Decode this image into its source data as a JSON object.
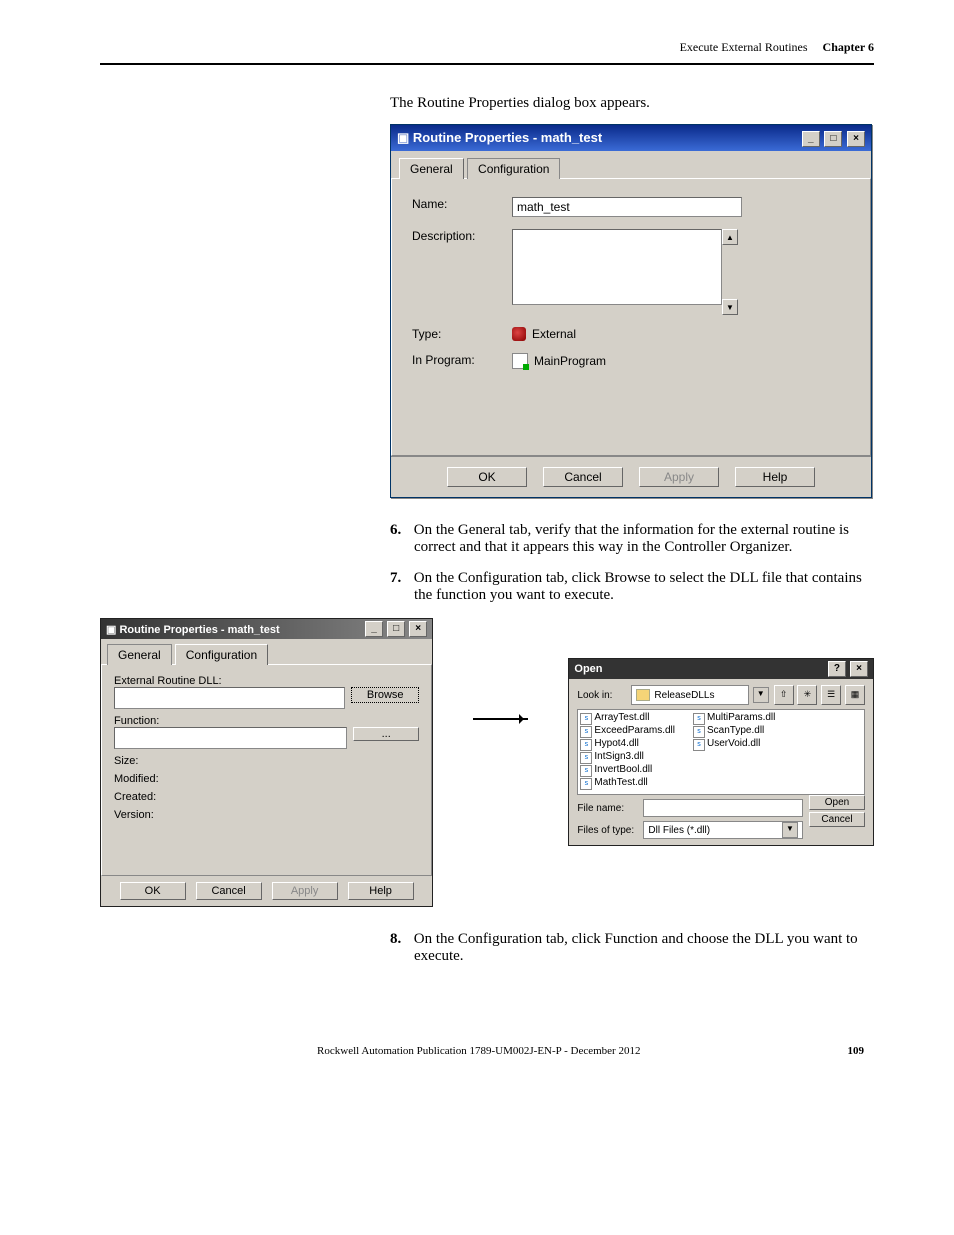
{
  "header": {
    "section_title": "Execute External Routines",
    "chapter": "Chapter 6"
  },
  "intro": "The Routine Properties dialog box appears.",
  "dialog1": {
    "title": "Routine Properties - math_test",
    "winbuttons": {
      "min": "_",
      "max": "□",
      "close": "×"
    },
    "tabs": {
      "general": "General",
      "configuration": "Configuration"
    },
    "labels": {
      "name": "Name:",
      "description": "Description:",
      "type": "Type:",
      "in_program": "In Program:"
    },
    "values": {
      "name": "math_test",
      "description": "",
      "type": "External",
      "in_program": "MainProgram"
    },
    "buttons": {
      "ok": "OK",
      "cancel": "Cancel",
      "apply": "Apply",
      "help": "Help"
    }
  },
  "step6": {
    "num": "6.",
    "text": "On the General tab, verify that the information for the external routine is correct and that it appears this way in the Controller Organizer."
  },
  "step7": {
    "num": "7.",
    "text": "On the Configuration tab, click Browse to select the DLL file that contains the function you want to execute."
  },
  "dialog2": {
    "title": "Routine Properties - math_test",
    "winbuttons": {
      "min": "_",
      "max": "□",
      "close": "×"
    },
    "tabs": {
      "general": "General",
      "configuration": "Configuration"
    },
    "labels": {
      "dll": "External Routine DLL:",
      "function": "Function:",
      "size": "Size:",
      "modified": "Modified:",
      "created": "Created:",
      "version": "Version:"
    },
    "browse": "Browse",
    "ellipsis": "...",
    "buttons": {
      "ok": "OK",
      "cancel": "Cancel",
      "apply": "Apply",
      "help": "Help"
    }
  },
  "dialog3": {
    "title": "Open",
    "help_q": "?",
    "close": "×",
    "lookin_label": "Look in:",
    "lookin_value": "ReleaseDLLs",
    "files_col1": [
      "ArrayTest.dll",
      "ExceedParams.dll",
      "Hypot4.dll",
      "IntSign3.dll",
      "InvertBool.dll",
      "MathTest.dll"
    ],
    "files_col2": [
      "MultiParams.dll",
      "ScanType.dll",
      "UserVoid.dll"
    ],
    "filename_label": "File name:",
    "filename_value": "",
    "filetype_label": "Files of type:",
    "filetype_value": "Dll Files (*.dll)",
    "open_btn": "Open",
    "cancel_btn": "Cancel"
  },
  "step8": {
    "num": "8.",
    "text": "On the Configuration tab, click Function and choose the DLL you want to execute."
  },
  "footer": {
    "pub": "Rockwell Automation Publication 1789-UM002J-EN-P - December 2012",
    "page": "109"
  }
}
